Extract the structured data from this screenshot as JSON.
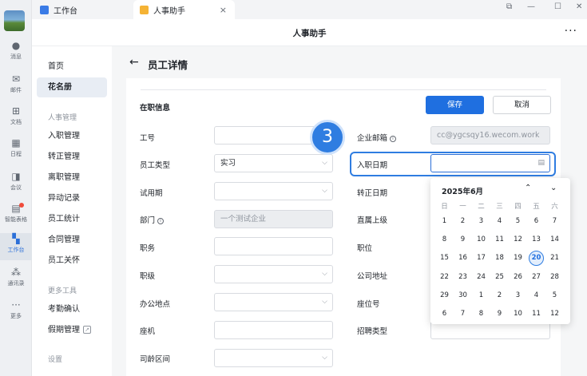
{
  "rail": [
    {
      "name": "messages",
      "label": "消息",
      "icon": "chat-bubble-icon"
    },
    {
      "name": "mail",
      "label": "邮件",
      "icon": "mail-icon"
    },
    {
      "name": "docs",
      "label": "文档",
      "icon": "document-icon"
    },
    {
      "name": "calendar",
      "label": "日程",
      "icon": "calendar-icon"
    },
    {
      "name": "meeting",
      "label": "会议",
      "icon": "meeting-icon"
    },
    {
      "name": "smart-table",
      "label": "智能表格",
      "icon": "smart-table-icon"
    },
    {
      "name": "workbench",
      "label": "工作台",
      "icon": "grid-icon"
    },
    {
      "name": "contacts",
      "label": "通讯录",
      "icon": "contacts-icon"
    },
    {
      "name": "more",
      "label": "更多",
      "icon": "more-dots-icon"
    }
  ],
  "tabs": {
    "workbench": "工作台",
    "hr_assistant": "人事助手",
    "close": "×"
  },
  "window_controls": [
    "⧉",
    "—",
    "☐",
    "✕"
  ],
  "header": {
    "title": "人事助手",
    "more": "···"
  },
  "subnav": {
    "items_top": [
      "首页",
      "花名册"
    ],
    "group1": "人事管理",
    "items_hr": [
      "入职管理",
      "转正管理",
      "离职管理",
      "异动记录",
      "员工统计",
      "合同管理",
      "员工关怀"
    ],
    "group2": "更多工具",
    "items_tools": [
      "考勤确认",
      "假期管理"
    ],
    "group3": "设置"
  },
  "page": {
    "back": "←",
    "title": "员工详情",
    "section_title": "在职信息",
    "save": "保存",
    "cancel": "取消",
    "step": "3"
  },
  "form_left": {
    "employee_no": "工号",
    "employee_type": "员工类型",
    "employee_type_value": "实习",
    "probation": "试用期",
    "department": "部门",
    "department_value": "一个测试企业",
    "position": "职务",
    "rank": "职级",
    "office": "办公地点",
    "phone": "座机",
    "service_range": "司龄区间"
  },
  "form_right": {
    "email": "企业邮箱",
    "email_value": "cc@ygcsqy16.wecom.work",
    "hire_date": "入职日期",
    "regular_date": "转正日期",
    "supervisor": "直属上级",
    "job": "职位",
    "company_address": "公司地址",
    "seat": "座位号",
    "recruit_type": "招聘类型"
  },
  "calendar": {
    "month": "2025年6月",
    "prev": "⌃",
    "next": "⌄",
    "weekdays": [
      "日",
      "一",
      "二",
      "三",
      "四",
      "五",
      "六"
    ],
    "weeks": [
      [
        "1",
        "2",
        "3",
        "4",
        "5",
        "6",
        "7"
      ],
      [
        "8",
        "9",
        "10",
        "11",
        "12",
        "13",
        "14"
      ],
      [
        "15",
        "16",
        "17",
        "18",
        "19",
        "20",
        "21"
      ],
      [
        "22",
        "23",
        "24",
        "25",
        "26",
        "27",
        "28"
      ],
      [
        "29",
        "30",
        "1",
        "2",
        "3",
        "4",
        "5"
      ],
      [
        "6",
        "7",
        "8",
        "9",
        "10",
        "11",
        "12"
      ]
    ],
    "today": "20"
  }
}
